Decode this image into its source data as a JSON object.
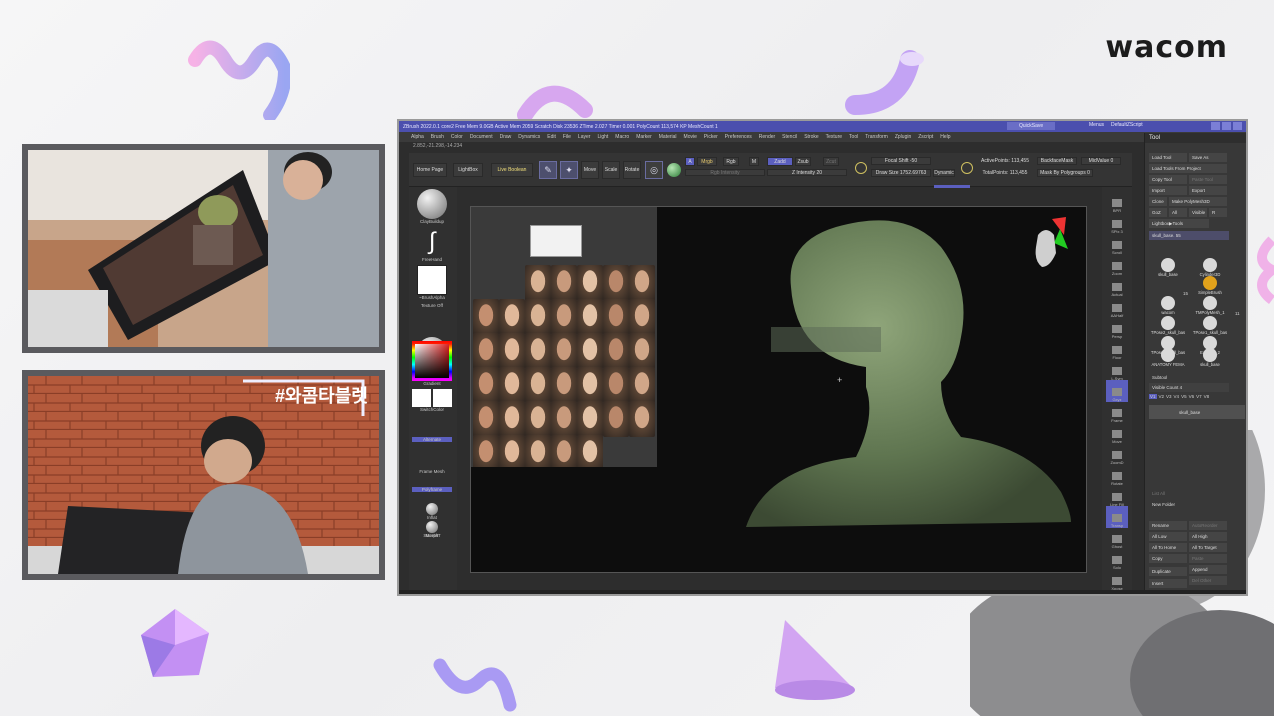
{
  "brand": {
    "logo_text": "wacom"
  },
  "stream": {
    "hashtag": "#와콤타블렛"
  },
  "zbrush": {
    "title": "ZBrush 2022.0.1   core2   Free Mem 9.0GB   Active Mem 2059   Scratch Disk 23536   ZTime 2.027 Timer 0.001   PolyCount 113,574 KP   MeshCount 1",
    "quicksave": "QuickSave",
    "menus_label": "Menus",
    "script_label": "DefaultZScript",
    "menu": [
      "Alpha",
      "Brush",
      "Color",
      "Document",
      "Draw",
      "Dynamics",
      "Edit",
      "File",
      "Layer",
      "Light",
      "Macro",
      "Marker",
      "Material",
      "Movie",
      "Picker",
      "Preferences",
      "Render",
      "Stencil",
      "Stroke",
      "Texture",
      "Tool",
      "Transform",
      "Zplugin",
      "Zscript",
      "Help"
    ],
    "coords": "2.852,-21.298,-14.234",
    "top": {
      "home_page": "Home Page",
      "lightbox": "LightBox",
      "live_boolean": "Live Boolean",
      "edit": "Edit",
      "draw": "Draw",
      "move": "Move",
      "scale": "Scale",
      "rotate": "Rotate",
      "a": "A",
      "mrgb": "Mrgb",
      "rgb": "Rgb",
      "m": "M",
      "zadd": "Zadd",
      "zsub": "Zsub",
      "zcut": "Zcut",
      "rgb_intensity": "Rgb Intensity",
      "z_intensity": "Z Intensity 20",
      "focal_shift": "Focal Shift -50",
      "draw_size": "Draw Size 1752.69763",
      "dynamic": "Dynamic",
      "active_points": "ActivePoints: 113,455",
      "total_points": "TotalPoints: 113,455",
      "backface_mask": "BackfaceMask",
      "mask_by_polygroups": "Mask By Polygroups 0",
      "midvalue": "MidValue 0"
    },
    "left_shelf": [
      {
        "label": "ClayBuildup"
      },
      {
        "label": "FreeHand"
      },
      {
        "label": "~BrushAlpha"
      },
      {
        "label": "Texture Off"
      },
      {
        "label": "25-greens-day"
      },
      {
        "label": "Gradient"
      },
      {
        "label": "SwitchColor"
      },
      {
        "label": "Alternate"
      },
      {
        "label": "Frame Mesh"
      },
      {
        "label": "Polyframe"
      },
      {
        "label": "Inflat"
      },
      {
        "label": "Morph"
      },
      {
        "label": "StoreMT"
      }
    ],
    "right_shelf": [
      "BPR",
      "SPix 3",
      "Scroll",
      "Zoom",
      "Actual",
      "AAHalf",
      "Persp",
      "Floor",
      "L.Sym",
      "Gxyz",
      "Frame",
      "Move",
      "ZoomD",
      "Rotate",
      "Line Fill",
      "Transp",
      "Ghost",
      "Solo",
      "Xpose"
    ],
    "tool_tray": {
      "title": "Tool",
      "buttons": [
        "Load Tool",
        "Save As",
        "Load Tools From Project",
        "Copy Tool",
        "Paste Tool",
        "Import",
        "Export",
        "Clone",
        "Make PolyMesh3D",
        "GoZ",
        "All",
        "Visible",
        "R",
        "Lightbox▶Tools"
      ],
      "current_tool": "skull_base. 55",
      "thumbs": [
        "skull_base",
        "Cylinder3D",
        "SimpleBrush",
        "wacom",
        "TMPolyMesh_1",
        "TPose2_skull_bas",
        "TPose1_skull_bas",
        "TPose1_skull_bas",
        "Extract2_2",
        "ANATOMY FEMA",
        "skull_base"
      ],
      "count_a": "15",
      "count_b": "11",
      "subtool": "Subtool",
      "visible_count": "Visible Count 4",
      "versions": [
        "V1",
        "V2",
        "V3",
        "V4",
        "V5",
        "V6",
        "V7",
        "V8"
      ],
      "subtool_item": "skull_base",
      "list_all": "List All",
      "new_folder": "New Folder",
      "actions": [
        "Rename",
        "AutoReorder",
        "All Low",
        "All High",
        "All To Home",
        "All To Target",
        "Copy",
        "Paste",
        "Duplicate",
        "Append",
        "Insert",
        "Del Other"
      ]
    }
  }
}
